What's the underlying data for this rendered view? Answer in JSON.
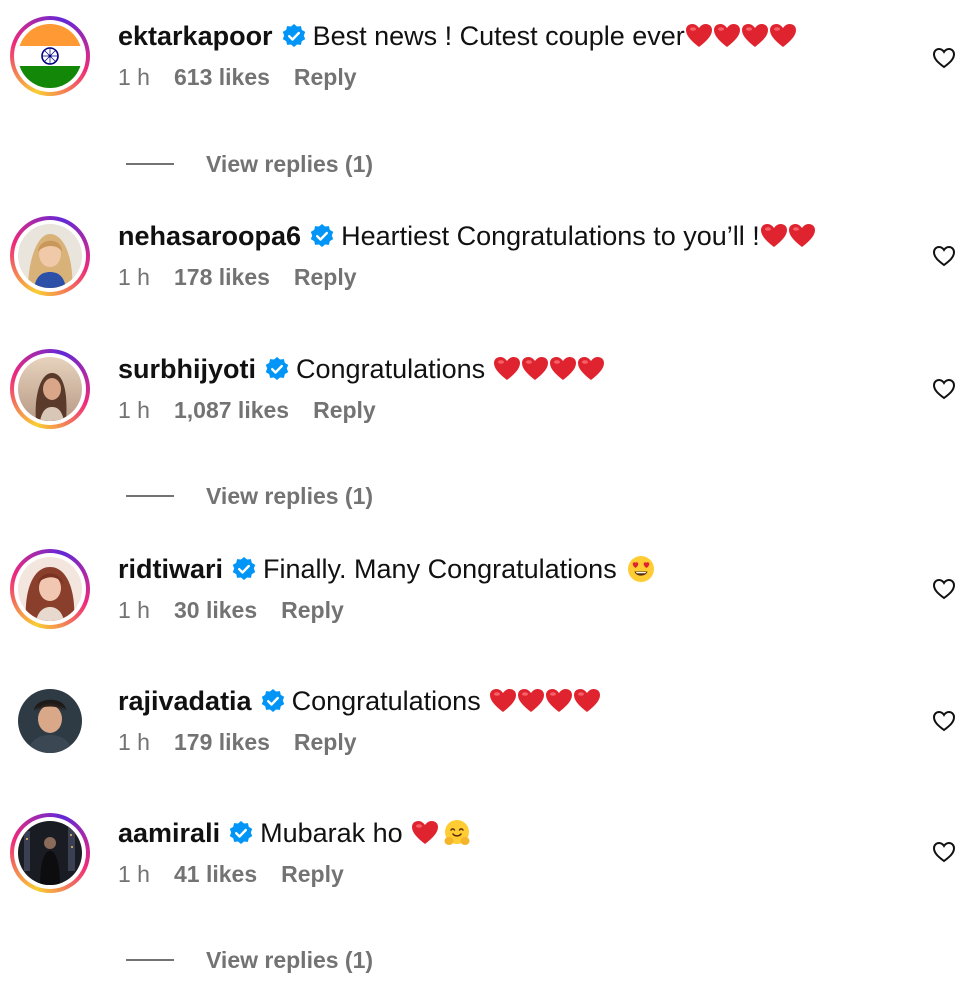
{
  "comments": [
    {
      "username": "ektarkapoor",
      "text": "Best news ! Cutest couple ever",
      "emojis": [
        "red-heart",
        "red-heart",
        "red-heart",
        "red-heart"
      ],
      "time": "1 h",
      "likes": "613 likes",
      "reply": "Reply",
      "view_replies": "View replies (1)",
      "avatar": "india-flag"
    },
    {
      "username": "nehasaroopa6",
      "text": "Heartiest Congratulations to you’ll !",
      "emojis": [
        "red-heart",
        "red-heart"
      ],
      "time": "1 h",
      "likes": "178 likes",
      "reply": "Reply",
      "avatar": "portrait-woman-blonde"
    },
    {
      "username": "surbhijyoti",
      "text": "Congratulations ",
      "emojis": [
        "red-heart",
        "red-heart",
        "red-heart",
        "red-heart"
      ],
      "time": "1 h",
      "likes": "1,087 likes",
      "reply": "Reply",
      "view_replies": "View replies (1)",
      "avatar": "portrait-woman-sunset"
    },
    {
      "username": "ridtiwari",
      "text": "Finally. Many Congratulations ",
      "emojis": [
        "heart-eyes-face"
      ],
      "time": "1 h",
      "likes": "30 likes",
      "reply": "Reply",
      "avatar": "portrait-woman-auburn"
    },
    {
      "username": "rajivadatia",
      "text": "Congratulations ",
      "emojis": [
        "red-heart",
        "red-heart",
        "red-heart",
        "red-heart"
      ],
      "time": "1 h",
      "likes": "179 likes",
      "reply": "Reply",
      "avatar": "portrait-man"
    },
    {
      "username": "aamirali",
      "text": "Mubarak ho ",
      "emojis": [
        "red-heart",
        "hugging-face"
      ],
      "time": "1 h",
      "likes": "41 likes",
      "reply": "Reply",
      "view_replies": "View replies (1)",
      "avatar": "portrait-man-city-night"
    }
  ],
  "icons": {
    "like": "heart-outline-icon",
    "verified": "verified-badge-icon"
  },
  "colors": {
    "verified_blue": "#0095f6",
    "secondary_text": "#737373",
    "primary_text": "#111111",
    "emoji_heart": "#e0242f"
  }
}
